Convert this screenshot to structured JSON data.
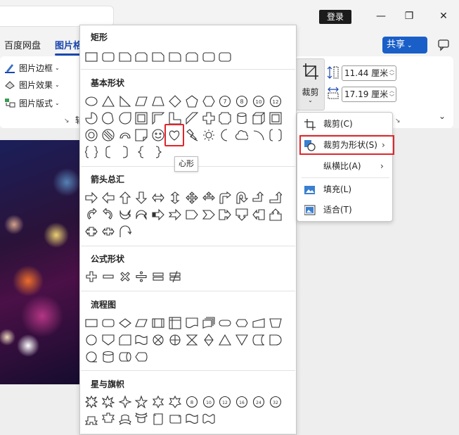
{
  "titlebar": {
    "login_label": "登录",
    "minimize_glyph": "—",
    "restore_glyph": "❐",
    "close_glyph": "✕"
  },
  "tabs": {
    "items": [
      "百度网盘",
      "图片格"
    ]
  },
  "share": {
    "label": "共享",
    "caret": "⌄"
  },
  "ribbon": {
    "picture_border": "图片边框",
    "picture_effects": "图片效果",
    "picture_layout": "图片版式",
    "group_partial_label": "辅",
    "crop_label": "裁剪",
    "height_value": "11.44 厘米",
    "width_value": "17.19 厘米"
  },
  "gallery": {
    "sections": [
      "矩形",
      "基本形状",
      "箭头总汇",
      "公式形状",
      "流程图",
      "星与旗帜"
    ],
    "tooltip": "心形"
  },
  "crop_menu": {
    "items": [
      {
        "label": "裁剪(C)",
        "icon": "crop-icon",
        "submenu": false
      },
      {
        "label": "裁剪为形状(S)",
        "icon": "crop-to-shape-icon",
        "submenu": true
      },
      {
        "label": "纵横比(A)",
        "icon": "",
        "submenu": true
      },
      {
        "label": "填充(L)",
        "icon": "fill-icon",
        "submenu": false
      },
      {
        "label": "适合(T)",
        "icon": "fit-icon",
        "submenu": false
      }
    ]
  },
  "colors": {
    "accent_blue": "#1a47b0",
    "share_blue": "#1a5fc8",
    "highlight_red": "#e0262b"
  }
}
